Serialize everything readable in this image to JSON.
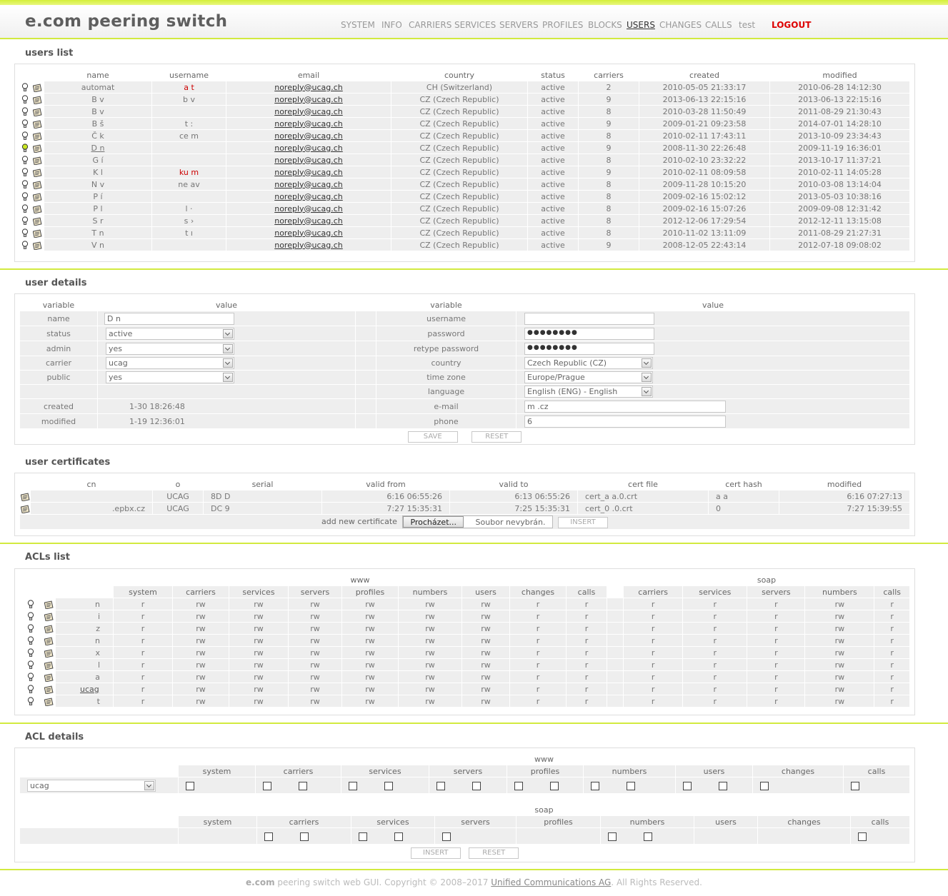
{
  "app": {
    "logo": "e.com peering switch"
  },
  "menu": [
    {
      "label": "SYSTEM"
    },
    {
      "label": "INFO"
    },
    {
      "label": "CARRIERS"
    },
    {
      "label": "SERVICES"
    },
    {
      "label": "SERVERS"
    },
    {
      "label": "PROFILES"
    },
    {
      "label": "BLOCKS"
    },
    {
      "label": "USERS",
      "active": true
    },
    {
      "label": "CHANGES"
    },
    {
      "label": "CALLS"
    },
    {
      "label": "test"
    },
    {
      "label": "LOGOUT"
    }
  ],
  "users_list": {
    "title": "users list",
    "headers": [
      "name",
      "username",
      "email",
      "country",
      "status",
      "carriers",
      "created",
      "modified"
    ],
    "rows": [
      {
        "name": "automat",
        "username": "a        t",
        "username_red": true,
        "email": "noreply@ucag.ch",
        "country": "CH (Switzerland)",
        "status": "active",
        "carriers": "2",
        "created": "2010-05-05 21:33:17",
        "modified": "2010-06-28 14:12:30"
      },
      {
        "name": "B            v",
        "username": "b           v",
        "email": "noreply@ucag.ch",
        "country": "CZ (Czech Republic)",
        "status": "active",
        "carriers": "9",
        "created": "2013-06-13 22:15:16",
        "modified": "2013-06-13 22:15:16"
      },
      {
        "name": "B            v",
        "username": "",
        "email": "noreply@ucag.ch",
        "country": "CZ (Czech Republic)",
        "status": "active",
        "carriers": "8",
        "created": "2010-03-28 11:50:49",
        "modified": "2011-08-29 21:30:43"
      },
      {
        "name": "B          š",
        "username": "t          :",
        "email": "noreply@ucag.ch",
        "country": "CZ (Czech Republic)",
        "status": "active",
        "carriers": "9",
        "created": "2009-01-21 09:23:58",
        "modified": "2014-07-01 14:28:10"
      },
      {
        "name": "Č                k",
        "username": "ce        m",
        "email": "noreply@ucag.ch",
        "country": "CZ (Czech Republic)",
        "status": "active",
        "carriers": "8",
        "created": "2010-02-11 17:43:11",
        "modified": "2013-10-09 23:34:43"
      },
      {
        "name": "D           n",
        "username": "",
        "email": "noreply@ucag.ch",
        "country": "CZ (Czech Republic)",
        "status": "active",
        "carriers": "9",
        "created": "2008-11-30 22:26:48",
        "modified": "2009-11-19 16:36:01",
        "lit": true,
        "underline": true
      },
      {
        "name": "G          í",
        "username": "",
        "email": "noreply@ucag.ch",
        "country": "CZ (Czech Republic)",
        "status": "active",
        "carriers": "8",
        "created": "2010-02-10 23:32:22",
        "modified": "2013-10-17 11:37:21"
      },
      {
        "name": "K             l",
        "username": "ku        m",
        "username_red": true,
        "email": "noreply@ucag.ch",
        "country": "CZ (Czech Republic)",
        "status": "active",
        "carriers": "9",
        "created": "2010-02-11 08:09:58",
        "modified": "2010-02-11 14:05:28"
      },
      {
        "name": "N             v",
        "username": "ne        av",
        "email": "noreply@ucag.ch",
        "country": "CZ (Czech Republic)",
        "status": "active",
        "carriers": "8",
        "created": "2009-11-28 10:15:20",
        "modified": "2010-03-08 13:14:04"
      },
      {
        "name": "P          í",
        "username": "",
        "email": "noreply@ucag.ch",
        "country": "CZ (Czech Republic)",
        "status": "active",
        "carriers": "8",
        "created": "2009-02-16 15:02:12",
        "modified": "2013-05-03 10:38:16"
      },
      {
        "name": "P          l",
        "username": "l        ·",
        "email": "noreply@ucag.ch",
        "country": "CZ (Czech Republic)",
        "status": "active",
        "carriers": "8",
        "created": "2009-02-16 15:07:26",
        "modified": "2009-09-08 12:31:42"
      },
      {
        "name": "S          r",
        "username": "s        ›",
        "email": "noreply@ucag.ch",
        "country": "CZ (Czech Republic)",
        "status": "active",
        "carriers": "8",
        "created": "2012-12-06 17:29:54",
        "modified": "2012-12-11 13:15:08"
      },
      {
        "name": "T             n",
        "username": "t        ı",
        "email": "noreply@ucag.ch",
        "country": "CZ (Czech Republic)",
        "status": "active",
        "carriers": "8",
        "created": "2010-11-02 13:11:09",
        "modified": "2011-08-29 21:27:31"
      },
      {
        "name": "V             n",
        "username": "",
        "email": "noreply@ucag.ch",
        "country": "CZ (Czech Republic)",
        "status": "active",
        "carriers": "9",
        "created": "2008-12-05 22:43:14",
        "modified": "2012-07-18 09:08:02"
      }
    ]
  },
  "user_details": {
    "title": "user details",
    "h_variable": "variable",
    "h_value": "value",
    "name_label": "name",
    "name_value": "D           n",
    "status_label": "status",
    "status_value": "active",
    "admin_label": "admin",
    "admin_value": "yes",
    "carrier_label": "carrier",
    "carrier_value": "ucag",
    "public_label": "public",
    "public_value": "yes",
    "created_label": "created",
    "created_value": "1-30 18:26:48",
    "modified_label": "modified",
    "modified_value": "1-19 12:36:01",
    "username_label": "username",
    "username_value": "",
    "password_label": "password",
    "password_value": "●●●●●●●●",
    "retype_label": "retype password",
    "retype_value": "●●●●●●●●",
    "country_label": "country",
    "country_value": "Czech Republic (CZ)",
    "timezone_label": "time zone",
    "timezone_value": "Europe/Prague",
    "language_label": "language",
    "language_value": "English (ENG) - English",
    "email_label": "e-mail",
    "email_value": "m                    .cz",
    "phone_label": "phone",
    "phone_value": "6",
    "save_label": "SAVE",
    "reset_label": "RESET"
  },
  "certificates": {
    "title": "user certificates",
    "headers": [
      "cn",
      "o",
      "serial",
      "valid from",
      "valid to",
      "cert file",
      "cert hash",
      "modified"
    ],
    "rows": [
      {
        "cn": "",
        "o": "UCAG",
        "serial": "8D                    D",
        "valid_from": "6:16 06:55:26",
        "valid_to": "6:13 06:55:26",
        "cert_file": "cert_a          a.0.crt",
        "cert_hash": "a             a",
        "modified": "6:16 07:27:13"
      },
      {
        "cn": ".epbx.cz",
        "o": "UCAG",
        "serial": "DC                    9",
        "valid_from": "7:27 15:35:31",
        "valid_to": "7:25 15:35:31",
        "cert_file": "cert_0          .0.crt",
        "cert_hash": "0",
        "modified": "7:27 15:39:55"
      }
    ],
    "add_label": "add new certificate",
    "browse_label": "Procházet...",
    "nofile_label": "Soubor nevybrán.",
    "insert_label": "INSERT"
  },
  "acls_list": {
    "title": "ACLs list",
    "group_www": "www",
    "group_soap": "soap",
    "www_headers": [
      "system",
      "carriers",
      "services",
      "servers",
      "profiles",
      "numbers",
      "users",
      "changes",
      "calls"
    ],
    "soap_headers": [
      "carriers",
      "services",
      "servers",
      "numbers",
      "calls"
    ],
    "rows": [
      {
        "name": "n",
        "www": [
          "r",
          "rw",
          "rw",
          "rw",
          "rw",
          "rw",
          "rw",
          "r",
          "r"
        ],
        "soap": [
          "r",
          "r",
          "r",
          "rw",
          "r"
        ]
      },
      {
        "name": "i",
        "www": [
          "r",
          "rw",
          "rw",
          "rw",
          "rw",
          "rw",
          "rw",
          "r",
          "r"
        ],
        "soap": [
          "r",
          "r",
          "r",
          "rw",
          "r"
        ]
      },
      {
        "name": "z",
        "www": [
          "r",
          "rw",
          "rw",
          "rw",
          "rw",
          "rw",
          "rw",
          "r",
          "r"
        ],
        "soap": [
          "r",
          "r",
          "r",
          "rw",
          "r"
        ]
      },
      {
        "name": "n",
        "www": [
          "r",
          "rw",
          "rw",
          "rw",
          "rw",
          "rw",
          "rw",
          "r",
          "r"
        ],
        "soap": [
          "r",
          "r",
          "r",
          "rw",
          "r"
        ]
      },
      {
        "name": "x",
        "www": [
          "r",
          "rw",
          "rw",
          "rw",
          "rw",
          "rw",
          "rw",
          "r",
          "r"
        ],
        "soap": [
          "r",
          "r",
          "r",
          "rw",
          "r"
        ]
      },
      {
        "name": "l",
        "www": [
          "r",
          "rw",
          "rw",
          "rw",
          "rw",
          "rw",
          "rw",
          "r",
          "r"
        ],
        "soap": [
          "r",
          "r",
          "r",
          "rw",
          "r"
        ]
      },
      {
        "name": "a",
        "www": [
          "r",
          "rw",
          "rw",
          "rw",
          "rw",
          "rw",
          "rw",
          "r",
          "r"
        ],
        "soap": [
          "r",
          "r",
          "r",
          "rw",
          "r"
        ]
      },
      {
        "name": "ucag",
        "www": [
          "r",
          "rw",
          "rw",
          "rw",
          "rw",
          "rw",
          "rw",
          "r",
          "r"
        ],
        "soap": [
          "r",
          "r",
          "r",
          "rw",
          "r"
        ],
        "underline": true
      },
      {
        "name": "t",
        "www": [
          "r",
          "rw",
          "rw",
          "rw",
          "rw",
          "rw",
          "rw",
          "r",
          "r"
        ],
        "soap": [
          "r",
          "r",
          "r",
          "rw",
          "r"
        ]
      }
    ]
  },
  "acl_details": {
    "title": "ACL details",
    "group_www": "www",
    "group_soap": "soap",
    "www_headers": [
      "system",
      "carriers",
      "services",
      "servers",
      "profiles",
      "numbers",
      "users",
      "changes",
      "calls"
    ],
    "soap_headers": [
      "system",
      "carriers",
      "services",
      "servers",
      "profiles",
      "numbers",
      "users",
      "changes",
      "calls"
    ],
    "carrier_value": "ucag",
    "insert_label": "INSERT",
    "reset_label": "RESET"
  },
  "footer": {
    "brand": "e.com",
    "text": " peering switch web GUI. Copyright © 2008–2017 ",
    "link": "Unified Communications AG",
    "suffix": ". All Rights Reserved."
  }
}
